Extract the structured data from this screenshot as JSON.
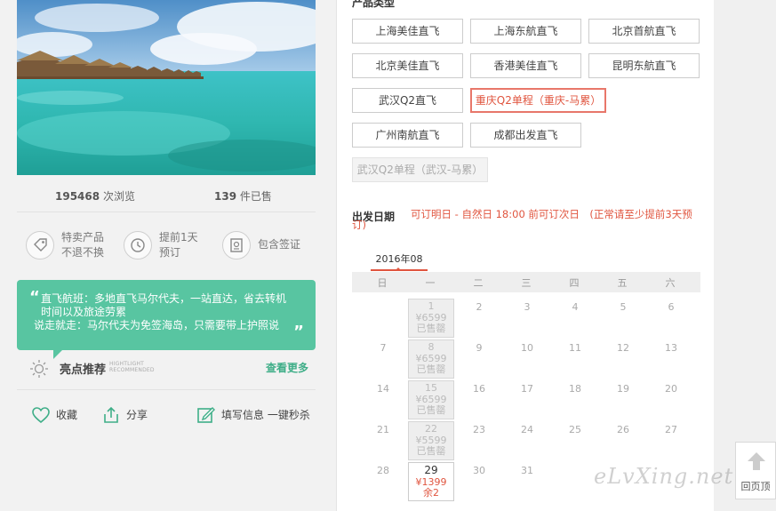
{
  "stats": {
    "views_count": "195468",
    "views_label": "次浏览",
    "sold_count": "139",
    "sold_label": "件已售"
  },
  "features": [
    {
      "icon": "tag-icon",
      "line1": "特卖产品",
      "line2": "不退不换"
    },
    {
      "icon": "clock-icon",
      "line1": "提前1天",
      "line2": "预订"
    },
    {
      "icon": "passport-icon",
      "line1": "包含签证",
      "line2": ""
    }
  ],
  "highlight": {
    "line1": "直飞航班：多地直飞马尔代夫，一站直达，省去转机",
    "line2": "时间以及旅途劳累",
    "line3": "说走就走：马尔代夫为免签海岛，只需要带上护照说",
    "title": "亮点推荐",
    "subtitle_line1": "HIGHTLIGHT",
    "subtitle_line2": "RECOMMENDED",
    "more_label": "查看更多"
  },
  "actions": {
    "favorite": "收藏",
    "share": "分享",
    "fill_info": "填写信息 一键秒杀"
  },
  "product_types": {
    "title": "产品类型",
    "items": [
      {
        "label": "上海美佳直飞",
        "state": "normal"
      },
      {
        "label": "上海东航直飞",
        "state": "normal"
      },
      {
        "label": "北京首航直飞",
        "state": "normal"
      },
      {
        "label": "北京美佳直飞",
        "state": "normal"
      },
      {
        "label": "香港美佳直飞",
        "state": "normal"
      },
      {
        "label": "昆明东航直飞",
        "state": "normal"
      },
      {
        "label": "武汉Q2直飞",
        "state": "normal"
      },
      {
        "label": "重庆Q2单程（重庆-马累）",
        "state": "selected"
      },
      {
        "label": "广州南航直飞",
        "state": "normal"
      },
      {
        "label": "成都出发直飞",
        "state": "normal"
      },
      {
        "label": "武汉Q2单程（武汉-马累）",
        "state": "disabled"
      }
    ]
  },
  "departure": {
    "title": "出发日期",
    "note": "可订明日 - 自然日 18:00 前可订次日　(正常请至少提前3天预订)"
  },
  "calendar": {
    "month_label": "2016年08",
    "weekdays": [
      "日",
      "一",
      "二",
      "三",
      "四",
      "五",
      "六"
    ],
    "rows": [
      [
        "",
        {
          "d": "1",
          "price": "¥6599",
          "status": "已售罄"
        },
        "2",
        "3",
        "4",
        "5",
        "6"
      ],
      [
        "7",
        {
          "d": "8",
          "price": "¥6599",
          "status": "已售罄"
        },
        "9",
        "10",
        "11",
        "12",
        "13"
      ],
      [
        "14",
        {
          "d": "15",
          "price": "¥6599",
          "status": "已售罄"
        },
        "16",
        "17",
        "18",
        "19",
        "20"
      ],
      [
        "21",
        {
          "d": "22",
          "price": "¥5599",
          "status": "已售罄"
        },
        "23",
        "24",
        "25",
        "26",
        "27"
      ],
      [
        "28",
        {
          "d": "29",
          "price": "¥1399",
          "status": "余2",
          "available": true
        },
        "30",
        "31",
        "",
        "",
        ""
      ]
    ]
  },
  "back_to_top": "回页顶",
  "watermark": "eLvXing.net",
  "colors": {
    "accent_green": "#58c5a1",
    "accent_red": "#e0553f"
  }
}
